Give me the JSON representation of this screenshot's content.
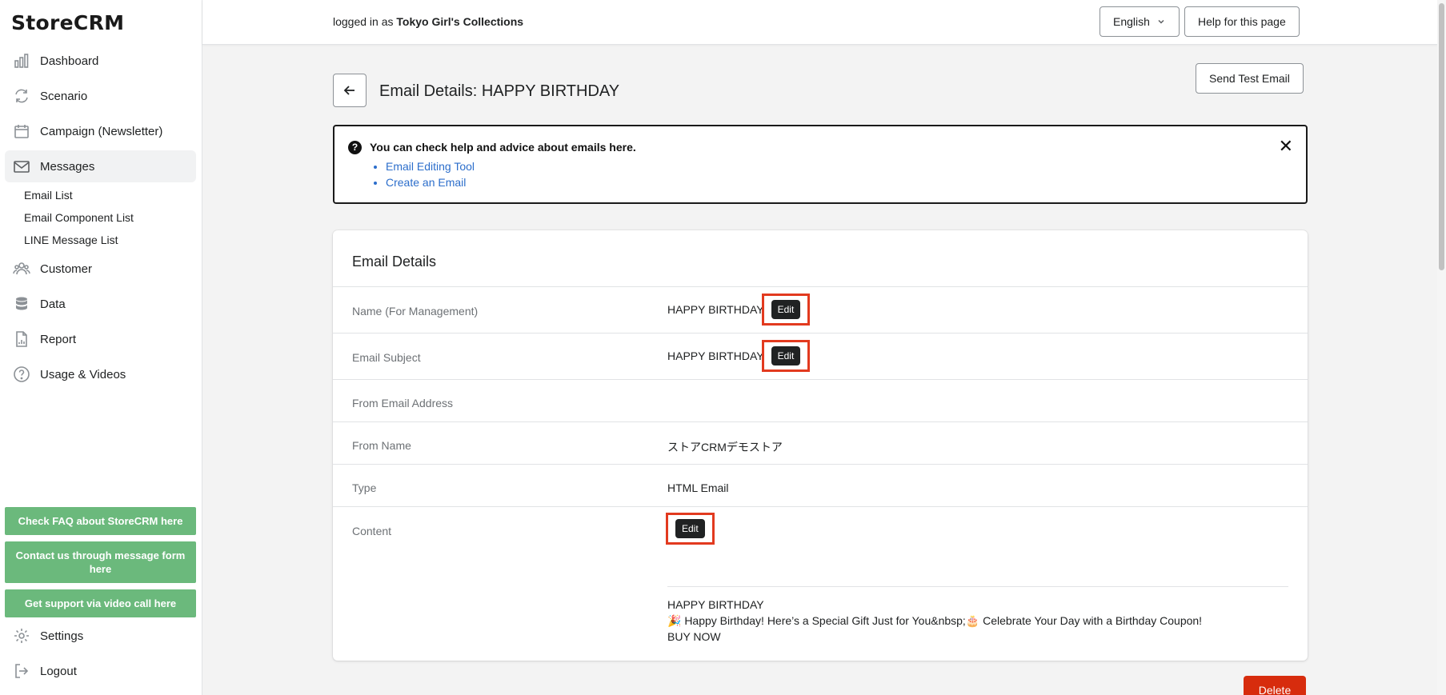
{
  "app": {
    "logo": "StoreCRM"
  },
  "sidebar": {
    "items": [
      {
        "label": "Dashboard",
        "icon": "bar-chart-icon"
      },
      {
        "label": "Scenario",
        "icon": "refresh-icon"
      },
      {
        "label": "Campaign (Newsletter)",
        "icon": "calendar-icon"
      },
      {
        "label": "Messages",
        "icon": "mail-icon",
        "active": true
      },
      {
        "label": "Customer",
        "icon": "users-icon"
      },
      {
        "label": "Data",
        "icon": "database-icon"
      },
      {
        "label": "Report",
        "icon": "document-icon"
      },
      {
        "label": "Usage & Videos",
        "icon": "question-icon"
      }
    ],
    "sub_items": [
      "Email List",
      "Email Component List",
      "LINE Message List"
    ],
    "support_buttons": [
      "Check FAQ about StoreCRM here",
      "Contact us through message form here",
      "Get support via video call here"
    ],
    "bottom": [
      {
        "label": "Settings",
        "icon": "gear-icon"
      },
      {
        "label": "Logout",
        "icon": "logout-icon"
      }
    ]
  },
  "topbar": {
    "logged_prefix": "logged in as",
    "store_name": "Tokyo Girl's Collections",
    "language": "English",
    "help": "Help for this page"
  },
  "header": {
    "title": "Email Details: HAPPY BIRTHDAY",
    "send_test": "Send Test Email"
  },
  "banner": {
    "title": "You can check help and advice about emails here.",
    "links": [
      "Email Editing Tool",
      "Create an Email"
    ],
    "close": "✕"
  },
  "details": {
    "card_title": "Email Details",
    "rows": [
      {
        "label": "Name (For Management)",
        "value": "HAPPY BIRTHDAY"
      },
      {
        "label": "Email Subject",
        "value": "HAPPY BIRTHDAY"
      },
      {
        "label": "From Email Address",
        "value": ""
      },
      {
        "label": "From Name",
        "value": "ストアCRMデモストア"
      },
      {
        "label": "Type",
        "value": "HTML Email"
      },
      {
        "label": "Content",
        "value": ""
      }
    ],
    "edit_label": "Edit",
    "content_lines": [
      "HAPPY BIRTHDAY",
      "🎉 Happy Birthday! Here’s a Special Gift Just for You&nbsp;🎂 Celebrate Your Day with a Birthday Coupon!",
      "BUY NOW"
    ]
  },
  "footer": {
    "delete": "Delete"
  },
  "colors": {
    "accent_green": "#6bb97c",
    "highlight_red": "#e23a1f",
    "delete_red": "#d72c0d",
    "link_blue": "#2c6ecb"
  }
}
